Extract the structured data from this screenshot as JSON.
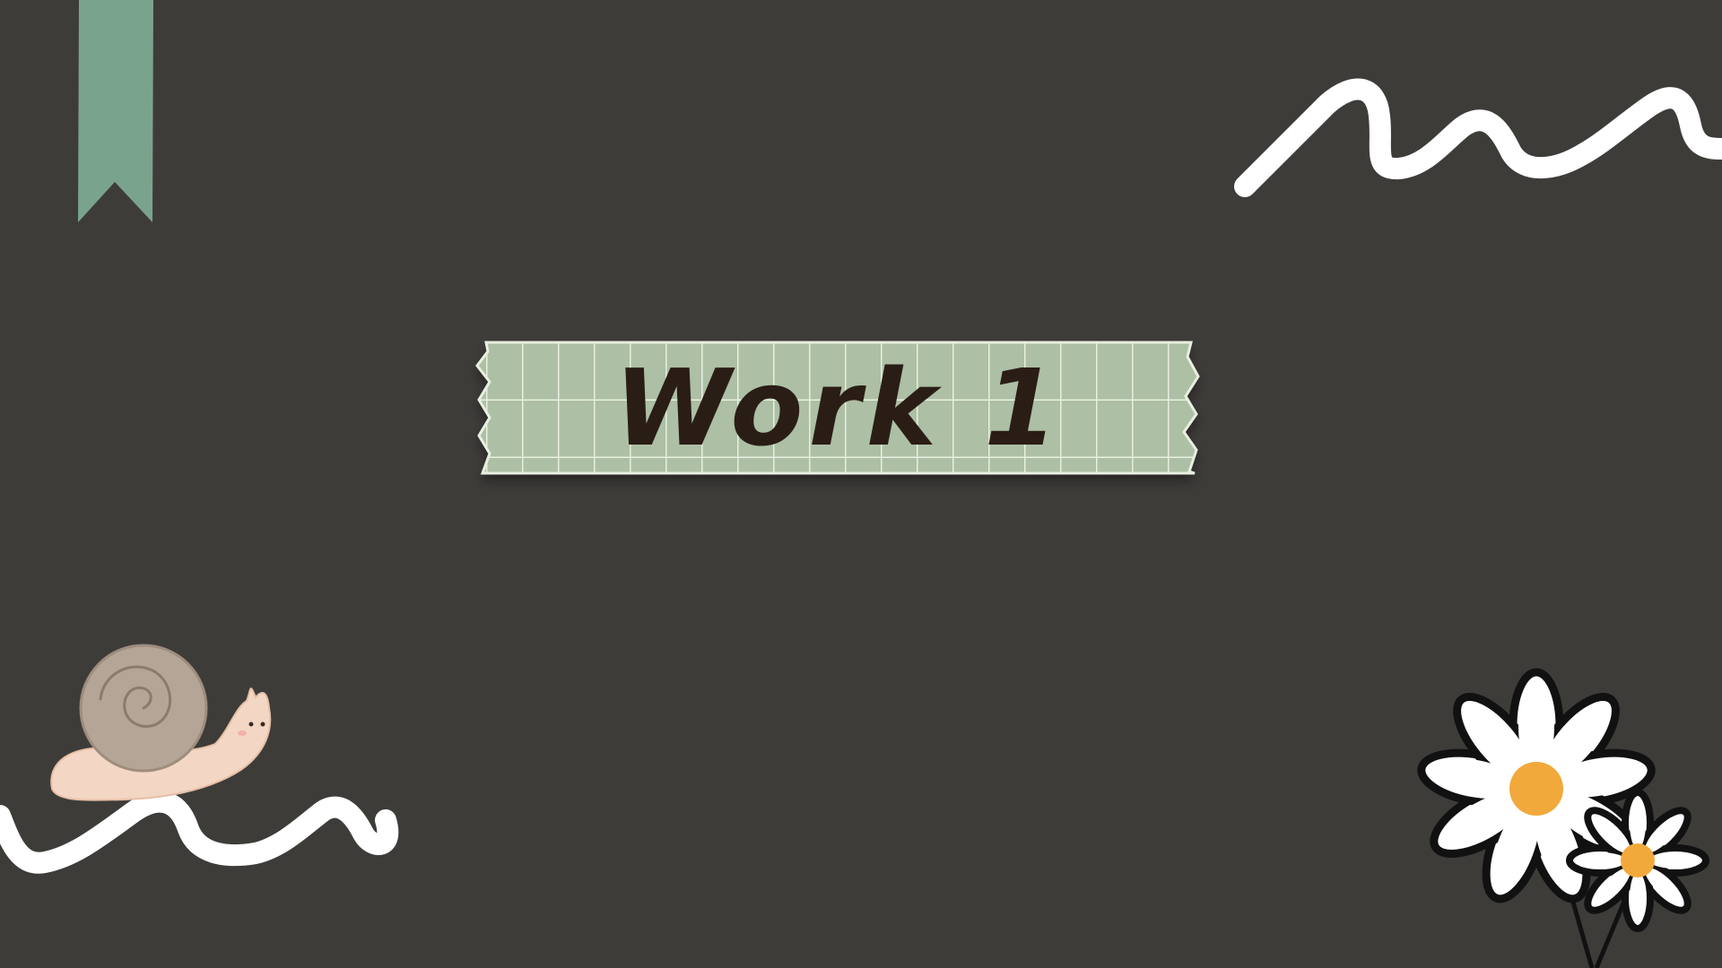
{
  "slide": {
    "title": "Work 1"
  },
  "colors": {
    "background": "#3e3c39",
    "tape": "#adbfa4",
    "tape_grid": "#e8efe0",
    "ribbon": "#7aa38e",
    "squiggle": "#ffffff",
    "title_text": "#2a1d16",
    "daisy_center": "#f2a93b",
    "snail_shell": "#b5a596",
    "snail_body": "#f3d6c4"
  },
  "decorations": [
    "bookmark-ribbon-icon",
    "white-squiggle-top-right",
    "washi-tape-banner",
    "snail-illustration",
    "white-squiggle-bottom-left",
    "daisy-flowers-illustration"
  ]
}
